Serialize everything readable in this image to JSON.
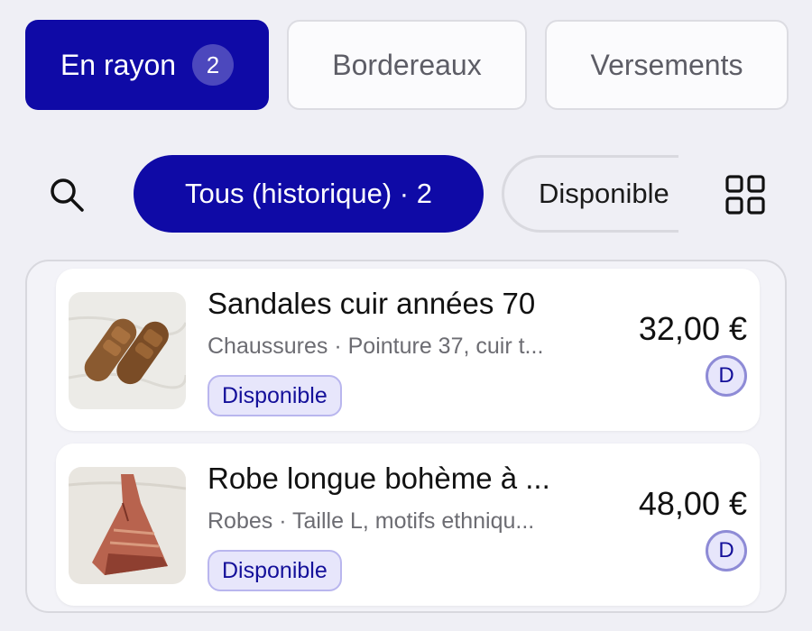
{
  "tabs": [
    {
      "label": "En rayon",
      "count": "2",
      "active": true
    },
    {
      "label": "Bordereaux"
    },
    {
      "label": "Versements"
    }
  ],
  "filters": {
    "search_icon": "search-icon",
    "chips": [
      {
        "label": "Tous (historique) · 2",
        "active": true
      },
      {
        "label": "Disponible"
      }
    ],
    "view_toggle_icon": "grid-icon"
  },
  "items": [
    {
      "title": "Sandales cuir années 70",
      "subtitle": "Chaussures · Pointure 37, cuir t...",
      "status": "Disponible",
      "price": "32,00 €",
      "avatar": "D"
    },
    {
      "title": "Robe longue bohème à ...",
      "subtitle": "Robes · Taille L, motifs ethniqu...",
      "status": "Disponible",
      "price": "48,00 €",
      "avatar": "D"
    }
  ],
  "colors": {
    "accent": "#0f0aa6",
    "badge_bg": "#e7e6fb",
    "badge_text": "#14109a",
    "background": "#efeff5"
  }
}
